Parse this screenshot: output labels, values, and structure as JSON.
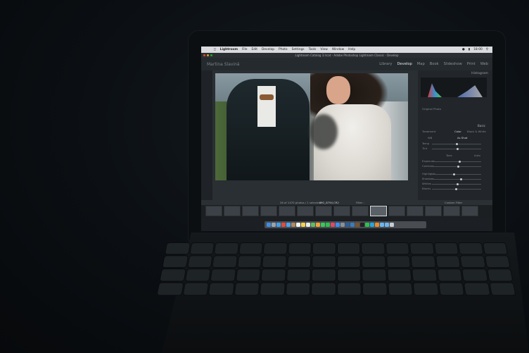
{
  "mac_menubar": {
    "items": [
      "Lightroom",
      "File",
      "Edit",
      "Develop",
      "Photo",
      "Settings",
      "Tools",
      "View",
      "Window",
      "Help"
    ],
    "clock": "18:00"
  },
  "window_title": "Lightroom Catalog 3.lrcat - Adobe Photoshop Lightroom Classic - Develop",
  "identity_plate": "Martina Slaviná",
  "modules": {
    "library": "Library",
    "develop": "Develop",
    "map": "Map",
    "book": "Book",
    "slideshow": "Slideshow",
    "print": "Print",
    "web": "Web"
  },
  "right_panel": {
    "histogram_title": "Histogram",
    "original_photo": "Original Photo",
    "basic_title": "Basic",
    "treatment": "Treatment",
    "color": "Color",
    "bw": "Black & White",
    "wb": "WB",
    "as_shot": "As Shot",
    "temp": "Temp",
    "tint": "Tint",
    "tone": "Tone",
    "auto": "Auto",
    "exposure": "Exposure",
    "contrast": "Contrast",
    "highlights": "Highlights",
    "shadows": "Shadows",
    "whites": "Whites",
    "blacks": "Blacks"
  },
  "toolbar": {
    "photo_count": "26 of 1470 photos / 1 selected",
    "filename": "IMG_8794.CR2",
    "filter_label": "Filter :",
    "custom_filter": "Custom Filter"
  },
  "colors": {
    "menubar": "#d9dbde",
    "panel_bg": "#22262a",
    "active_module": "#e3e6e8"
  }
}
